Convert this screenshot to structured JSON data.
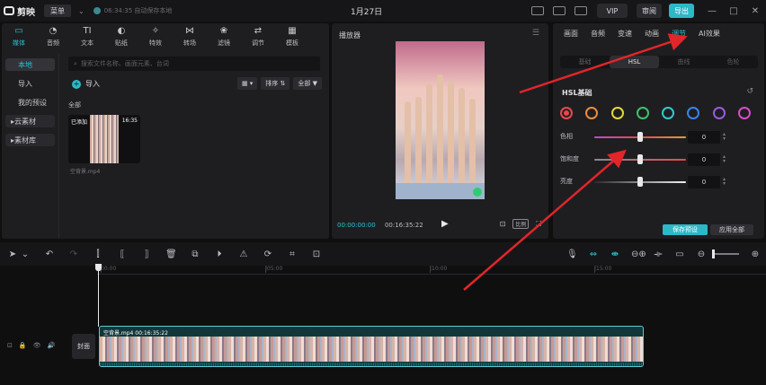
{
  "titlebar": {
    "app_name": "剪映",
    "menu_label": "菜单",
    "autosave": "06:34:35 自动保存本地",
    "project_title": "1月27日",
    "vip_label": "VIP",
    "share_label": "审阅",
    "export_label": "导出",
    "window_controls": [
      "—",
      "□",
      "✕"
    ]
  },
  "media_tabs": [
    {
      "label": "媒体",
      "icon": "media-icon",
      "glyph": "▭"
    },
    {
      "label": "音频",
      "icon": "audio-icon",
      "glyph": "◔"
    },
    {
      "label": "文本",
      "icon": "text-icon",
      "glyph": "TI"
    },
    {
      "label": "贴纸",
      "icon": "sticker-icon",
      "glyph": "◐"
    },
    {
      "label": "特效",
      "icon": "effects-icon",
      "glyph": "✧"
    },
    {
      "label": "转场",
      "icon": "transition-icon",
      "glyph": "⋈"
    },
    {
      "label": "滤镜",
      "icon": "filter-icon",
      "glyph": "❀"
    },
    {
      "label": "调节",
      "icon": "adjust-icon",
      "glyph": "⇄"
    },
    {
      "label": "模板",
      "icon": "template-icon",
      "glyph": "▦"
    }
  ],
  "sidebar": {
    "items": [
      {
        "label": "本地",
        "active": true
      },
      {
        "label": "导入"
      },
      {
        "label": "我的预设"
      },
      {
        "label": "云素材",
        "boxed": true
      },
      {
        "label": "素材库",
        "boxed": true
      }
    ]
  },
  "media": {
    "search_placeholder": "搜索文件名称、画面元素、台词",
    "import_label": "导入",
    "view_label": "▦ ▾",
    "sort_label": "排序 ⇅",
    "filter_label": "全部 ▼",
    "section_label": "全部",
    "clip": {
      "badge": "已添加",
      "duration": "16:35",
      "filename": "空背景.mp4"
    }
  },
  "player": {
    "title": "播放器",
    "current_time": "00:00:00:00",
    "total_time": "00:16:35:22",
    "ratio_label": "比例",
    "play_glyph": "▶"
  },
  "inspector": {
    "tabs": [
      {
        "label": "画面"
      },
      {
        "label": "音频"
      },
      {
        "label": "变速"
      },
      {
        "label": "动画"
      },
      {
        "label": "调节",
        "active": true
      },
      {
        "label": "AI效果"
      }
    ],
    "sub_tabs": [
      {
        "label": "基础"
      },
      {
        "label": "HSL",
        "active": true
      },
      {
        "label": "曲线"
      },
      {
        "label": "色轮"
      }
    ],
    "hsl_title": "HSL基础",
    "swatches": [
      {
        "name": "red",
        "color": "#e5484d",
        "selected": true
      },
      {
        "name": "orange",
        "color": "#f08c3a"
      },
      {
        "name": "yellow",
        "color": "#e6d83a"
      },
      {
        "name": "green",
        "color": "#3ec36a"
      },
      {
        "name": "cyan",
        "color": "#35c9c9"
      },
      {
        "name": "blue",
        "color": "#3a84e6"
      },
      {
        "name": "purple",
        "color": "#9b5ae0"
      },
      {
        "name": "magenta",
        "color": "#d94dc8"
      }
    ],
    "sliders": [
      {
        "label": "色相",
        "value": "0",
        "level": 0.5,
        "track": "linear-gradient(90deg,#c24ac8,#e5484d 50%,#e0a030)"
      },
      {
        "label": "饱和度",
        "value": "0",
        "level": 0.5,
        "track": "linear-gradient(90deg,#8a8a90,#e5484d)"
      },
      {
        "label": "亮度",
        "value": "0",
        "level": 0.5,
        "track": "linear-gradient(90deg,#2a2a2e,#f0f0f0)"
      }
    ],
    "save_preset": "保存预设",
    "apply_all": "应用全部"
  },
  "timeline": {
    "tools_left": [
      {
        "glyph": "➤",
        "name": "select-tool-icon"
      },
      {
        "glyph": "⌄",
        "name": "select-dropdown-icon"
      },
      {
        "glyph": "↶",
        "name": "undo-icon"
      },
      {
        "glyph": "↷",
        "name": "redo-icon",
        "dim": true
      },
      {
        "glyph": "⫿",
        "name": "split-icon"
      },
      {
        "glyph": "⟦",
        "name": "trim-left-icon"
      },
      {
        "glyph": "⟧",
        "name": "trim-right-icon"
      },
      {
        "glyph": "🗑",
        "name": "delete-icon"
      },
      {
        "glyph": "⧉",
        "name": "freeze-icon"
      },
      {
        "glyph": "⏵",
        "name": "reverse-icon"
      },
      {
        "glyph": "⚠",
        "name": "mirror-icon"
      },
      {
        "glyph": "⟳",
        "name": "rotate-icon"
      },
      {
        "glyph": "⌗",
        "name": "crop-icon"
      },
      {
        "glyph": "⊡",
        "name": "smart-crop-icon"
      }
    ],
    "tools_right": [
      {
        "glyph": "🎙",
        "name": "record-audio-icon"
      },
      {
        "glyph": "⇔",
        "name": "main-track-magnet-icon",
        "accent": true
      },
      {
        "glyph": "⇼",
        "name": "auto-snap-icon",
        "accent": true
      },
      {
        "glyph": "⊖⊕",
        "name": "link-icon"
      },
      {
        "glyph": "⟛",
        "name": "preview-axis-icon"
      },
      {
        "glyph": "▭",
        "name": "subtitle-icon"
      },
      {
        "glyph": "⊖",
        "name": "zoom-out-icon"
      },
      {
        "glyph": "⊕",
        "name": "zoom-in-icon"
      }
    ],
    "ruler": [
      "00:00",
      "|05:00",
      "|10:00",
      "|15:00"
    ],
    "track_controls": [
      "⊡",
      "🔒",
      "👁",
      "🔊"
    ],
    "cover_label": "封面",
    "clip_label": "空背景.mp4  00:16:35:22"
  }
}
